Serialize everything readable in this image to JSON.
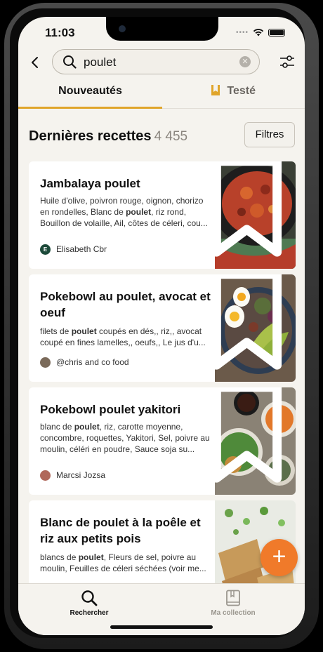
{
  "status": {
    "time": "11:03"
  },
  "search": {
    "query": "poulet"
  },
  "tabs": {
    "new": "Nouveautés",
    "tested": "Testé"
  },
  "list": {
    "heading": "Dernières recettes",
    "count": "4 455",
    "filters_label": "Filtres"
  },
  "recipes": [
    {
      "title": "Jambalaya poulet",
      "ingredients_before": "Huile d'olive, poivron rouge, oignon, chorizo en rondelles, Blanc de ",
      "ingredients_bold": "poulet",
      "ingredients_after": ", riz rond, Bouillon de volaille, Ail, côtes de céleri, cou...",
      "author": "Elisabeth Cbr",
      "avatar_letter": "E"
    },
    {
      "title": "Pokebowl au poulet, avocat et oeuf",
      "ingredients_before": "filets de ",
      "ingredients_bold": "poulet",
      "ingredients_after": " coupés en dés,, riz,, avocat coupé en fines lamelles,, oeufs,, Le jus d'u...",
      "author": "@chris and co food",
      "avatar_letter": ""
    },
    {
      "title": "Pokebowl poulet yakitori",
      "ingredients_before": "blanc de ",
      "ingredients_bold": "poulet",
      "ingredients_after": ", riz, carotte moyenne, concombre, roquettes, Yakitori, Sel, poivre au moulin, céléri en poudre, Sauce soja su...",
      "author": "Marcsi Jozsa",
      "avatar_letter": ""
    },
    {
      "title": "Blanc de poulet à la poêle et riz aux petits pois",
      "ingredients_before": "blancs de ",
      "ingredients_bold": "poulet",
      "ingredients_after": ", Fleurs de sel, poivre au moulin, Feuilles de céleri séchées (voir me...",
      "author": "",
      "avatar_letter": ""
    }
  ],
  "nav": {
    "search": "Rechercher",
    "collection": "Ma collection"
  },
  "colors": {
    "accent": "#e0a52a",
    "fab": "#f07a2a",
    "background": "#f5f3ee"
  }
}
